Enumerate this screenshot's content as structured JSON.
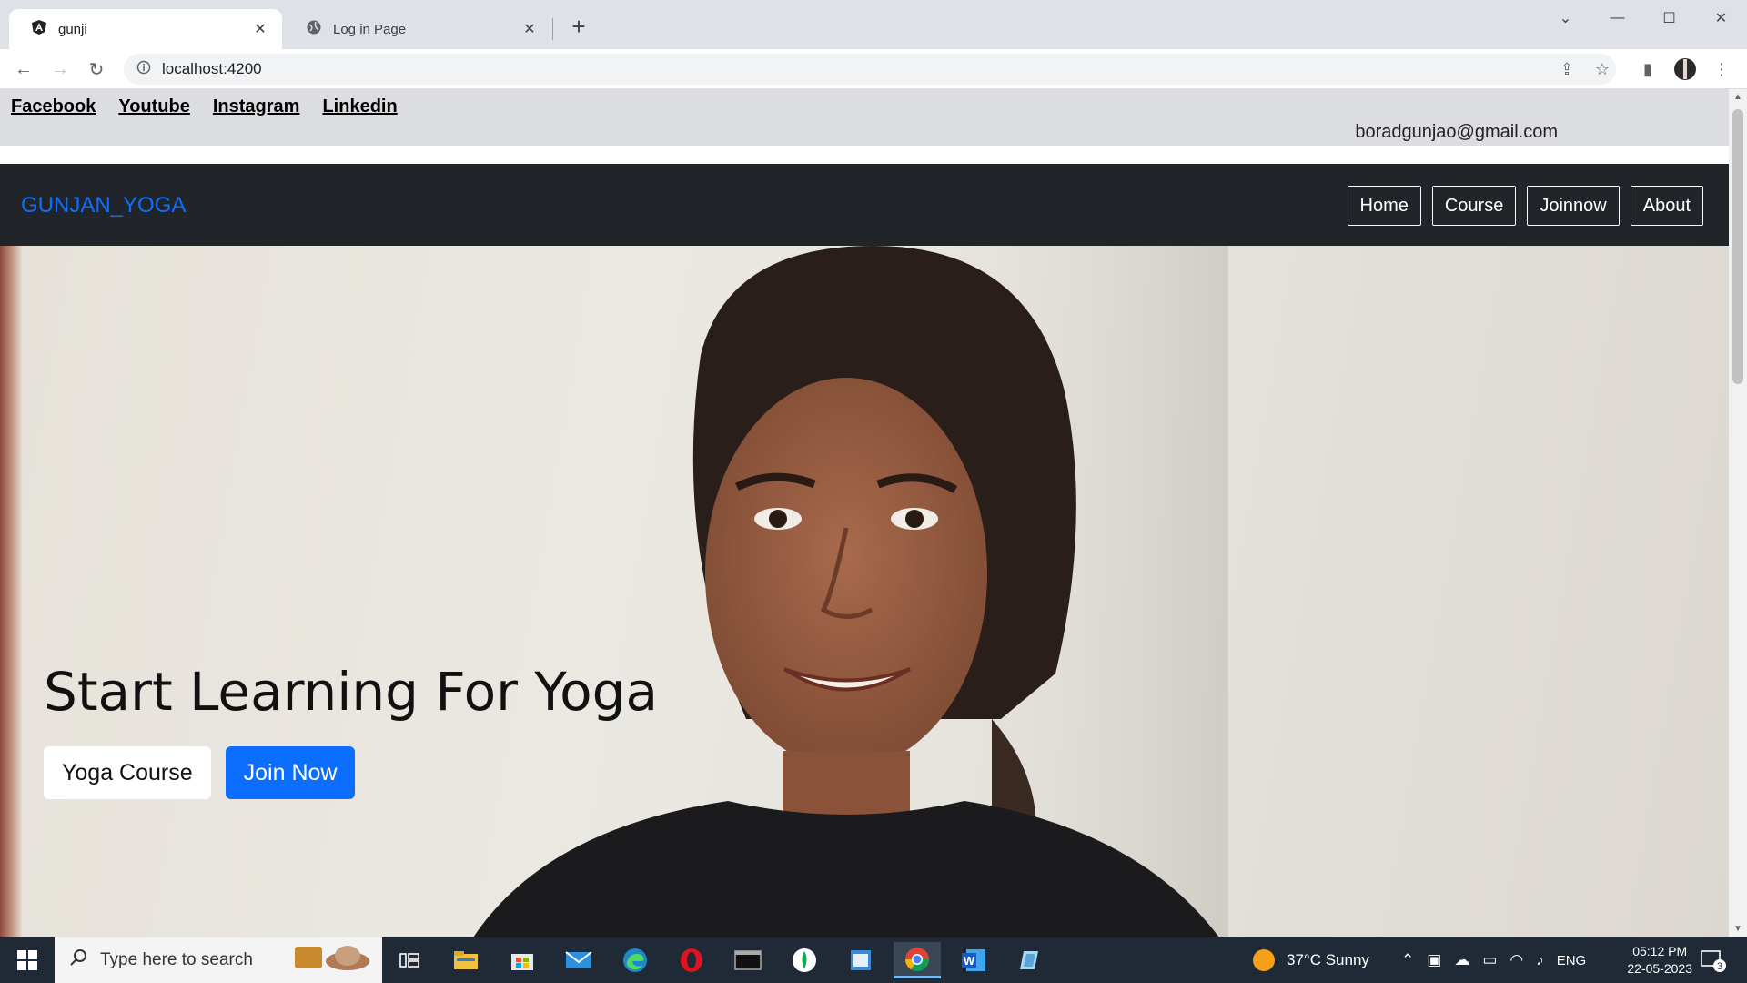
{
  "browser": {
    "tabs": [
      {
        "title": "gunji",
        "active": true
      },
      {
        "title": "Log in Page",
        "active": false
      }
    ],
    "url": "localhost:4200"
  },
  "social": {
    "links": [
      "Facebook",
      "Youtube",
      "Instagram",
      "Linkedin"
    ],
    "email": "boradgunjao@gmail.com"
  },
  "navbar": {
    "brand": "GUNJAN_YOGA",
    "items": [
      "Home",
      "Course",
      "Joinnow",
      "About"
    ],
    "brand_color": "#0d6efd",
    "bg_color": "#212529"
  },
  "hero": {
    "title": "Start Learning For Yoga",
    "btn_course": "Yoga Course",
    "btn_join": "Join Now"
  },
  "taskbar": {
    "search_placeholder": "Type here to search",
    "weather": "37°C  Sunny",
    "lang": "ENG",
    "time": "05:12 PM",
    "date": "22-05-2023",
    "notifications": "3"
  }
}
